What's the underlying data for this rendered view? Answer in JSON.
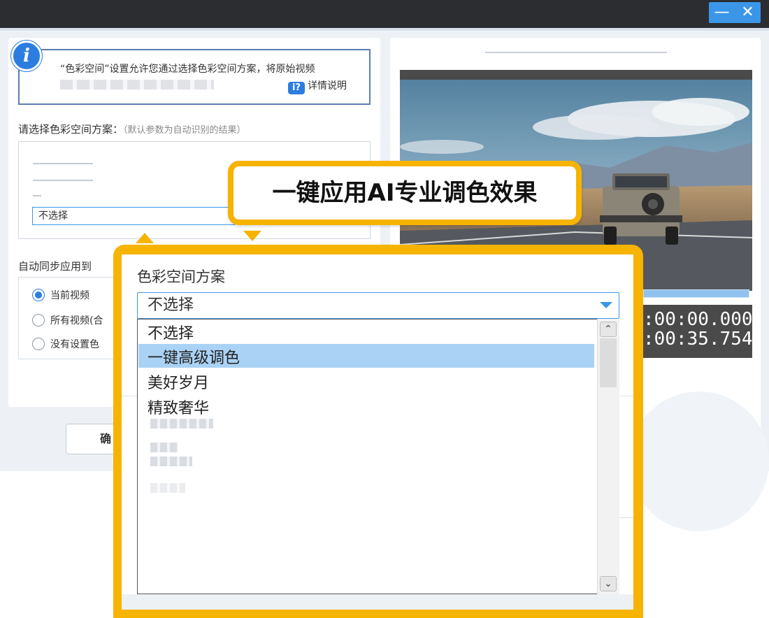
{
  "window": {
    "minimize_glyph": "—",
    "close_glyph": "✕"
  },
  "left": {
    "info_text": "“色彩空间”设置允许您通过选择色彩空间方案，将原始视频",
    "help_label": "详情说明",
    "help_icon_glyph": "i?",
    "scheme_label": "请选择色彩空间方案：",
    "scheme_hint": "（默认参数为自动识别的结果）",
    "scheme_selected": "不选择",
    "sync_label": "自动同步应用到",
    "radios": [
      {
        "label": "当前视频",
        "checked": true
      },
      {
        "label": "所有视频(合",
        "checked": false
      },
      {
        "label": "没有设置色",
        "checked": false
      }
    ],
    "confirm_label": "确",
    "peek_text": "自"
  },
  "right": {
    "time_current": ":00:00.000",
    "time_total": ":00:35.754",
    "progress": 1.0
  },
  "banner": {
    "text": "一键应用AI专业调色效果"
  },
  "zoom": {
    "title": "色彩空间方案",
    "selected": "不选择",
    "options": [
      "不选择",
      "一键高级调色",
      "美好岁月",
      "精致奢华"
    ],
    "highlighted_index": 1,
    "scroll_up": "⌃",
    "scroll_down": "⌄"
  },
  "colors": {
    "accent": "#3b96e8",
    "callout": "#f6b300",
    "highlight": "#aad2f5"
  }
}
